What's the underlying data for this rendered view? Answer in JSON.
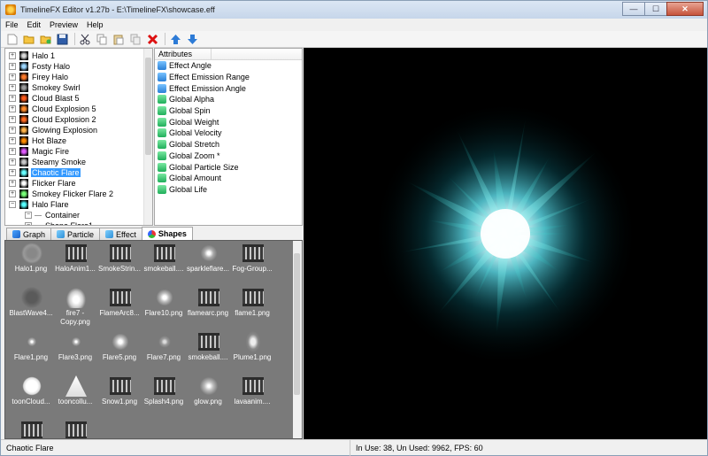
{
  "window": {
    "title": "TimelineFX Editor v1.27b - E:\\TimelineFX\\showcase.eff",
    "controls": [
      "—",
      "☐",
      "✕"
    ]
  },
  "menu": [
    "File",
    "Edit",
    "Preview",
    "Help"
  ],
  "toolbar": {
    "icons": [
      "new-file-icon",
      "open-folder-icon",
      "import-icon",
      "save-icon",
      "cut-icon",
      "copy-icon",
      "paste-icon",
      "duplicate-icon",
      "delete-icon",
      "move-up-icon",
      "move-down-icon"
    ]
  },
  "tree": {
    "items": [
      {
        "label": "Halo 1",
        "thumb": "#d9d9d9"
      },
      {
        "label": "Fosty Halo",
        "thumb": "#9bd6ff"
      },
      {
        "label": "Firey Halo",
        "thumb": "#ff7a2a"
      },
      {
        "label": "Smokey Swirl",
        "thumb": "#9b9b9b"
      },
      {
        "label": "Cloud Blast 5",
        "thumb": "#ff5a1a"
      },
      {
        "label": "Cloud Explosion 5",
        "thumb": "#ff8a2a"
      },
      {
        "label": "Cloud Explosion 2",
        "thumb": "#ff6a20"
      },
      {
        "label": "Glowing Explosion",
        "thumb": "#ffb44a"
      },
      {
        "label": "Hot Blaze",
        "thumb": "#ff8c00"
      },
      {
        "label": "Magic Fire",
        "thumb": "#e05aff"
      },
      {
        "label": "Steamy Smoke",
        "thumb": "#c8c8c8"
      },
      {
        "label": "Chaotic Flare",
        "thumb": "#6ff"
      },
      {
        "label": "Flicker Flare",
        "thumb": "#fff"
      },
      {
        "label": "Smokey Flicker Flare 2",
        "thumb": "#7f7"
      },
      {
        "label": "Halo Flare",
        "thumb": "#5ff"
      },
      {
        "label": "Container",
        "thumb": ""
      },
      {
        "label": "Shape Flare1",
        "thumb": ""
      }
    ],
    "selected": "Chaotic Flare"
  },
  "attributes": {
    "header": "Attributes",
    "items": [
      {
        "label": "Effect Angle",
        "color": "blue"
      },
      {
        "label": "Effect Emission Range",
        "color": "blue"
      },
      {
        "label": "Effect Emission Angle",
        "color": "blue"
      },
      {
        "label": "Global Alpha",
        "color": "green"
      },
      {
        "label": "Global Spin",
        "color": "green"
      },
      {
        "label": "Global Weight",
        "color": "green"
      },
      {
        "label": "Global Velocity",
        "color": "green"
      },
      {
        "label": "Global Stretch",
        "color": "green"
      },
      {
        "label": "Global Zoom *",
        "color": "green"
      },
      {
        "label": "Global Particle Size",
        "color": "green"
      },
      {
        "label": "Global Amount",
        "color": "green"
      },
      {
        "label": "Global Life",
        "color": "green"
      }
    ]
  },
  "tabs": [
    {
      "label": "Graph",
      "active": false
    },
    {
      "label": "Particle",
      "active": false
    },
    {
      "label": "Effect",
      "active": false
    },
    {
      "label": "Shapes",
      "active": true
    }
  ],
  "shapes": [
    {
      "label": "Halo1.png",
      "kind": "halo"
    },
    {
      "label": "HaloAnim1...",
      "kind": "film"
    },
    {
      "label": "SmokeStrin...",
      "kind": "film"
    },
    {
      "label": "smokeball....",
      "kind": "film"
    },
    {
      "label": "sparkleflare...",
      "kind": "sparkle"
    },
    {
      "label": "Fog-Group...",
      "kind": "film"
    },
    {
      "label": "BlastWave4...",
      "kind": "blast"
    },
    {
      "label": "fire7 - Copy.png",
      "kind": "fire"
    },
    {
      "label": "FlameArc8...",
      "kind": "film"
    },
    {
      "label": "Flare10.png",
      "kind": "flare"
    },
    {
      "label": "flamearc.png",
      "kind": "film"
    },
    {
      "label": "flame1.png",
      "kind": "film"
    },
    {
      "label": "Flare1.png",
      "kind": "smalldot"
    },
    {
      "label": "Flare3.png",
      "kind": "smalldot"
    },
    {
      "label": "Flare5.png",
      "kind": "flare"
    },
    {
      "label": "Flare7.png",
      "kind": "star"
    },
    {
      "label": "smokeball....",
      "kind": "film"
    },
    {
      "label": "Plume1.png",
      "kind": "plume"
    },
    {
      "label": "toonCloud...",
      "kind": "cloud"
    },
    {
      "label": "tooncollu...",
      "kind": "cone"
    },
    {
      "label": "Snow1.png",
      "kind": "film"
    },
    {
      "label": "Splash4.png",
      "kind": "film"
    },
    {
      "label": "glow.png",
      "kind": "glow"
    },
    {
      "label": "lavaanim....",
      "kind": "film"
    },
    {
      "label": "",
      "kind": "film"
    },
    {
      "label": "",
      "kind": "film"
    }
  ],
  "status": {
    "left": "Chaotic Flare",
    "right": "In Use: 38, Un Used: 9962, FPS: 60"
  }
}
